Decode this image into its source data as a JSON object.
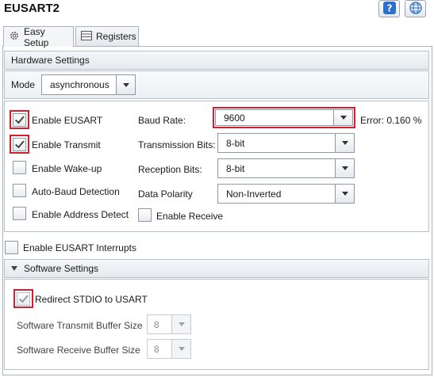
{
  "window": {
    "title": "EUSART2"
  },
  "header_buttons": [
    {
      "icon": "help-icon"
    },
    {
      "icon": "globe-icon"
    }
  ],
  "tabs": [
    {
      "label": "Easy Setup",
      "icon": "gear-icon",
      "active": true
    },
    {
      "label": "Registers",
      "icon": "register-list-icon",
      "active": false
    }
  ],
  "hardware": {
    "title": "Hardware Settings",
    "mode_label": "Mode",
    "mode_value": "asynchronous",
    "checkboxes": {
      "enable_eusart": {
        "label": "Enable EUSART",
        "checked": true
      },
      "enable_transmit": {
        "label": "Enable Transmit",
        "checked": true
      },
      "enable_wakeup": {
        "label": "Enable Wake-up",
        "checked": false
      },
      "auto_baud": {
        "label": "Auto-Baud Detection",
        "checked": false
      },
      "enable_address_detect": {
        "label": "Enable Address Detect",
        "checked": false
      },
      "enable_receive": {
        "label": "Enable Receive",
        "checked": false
      }
    },
    "baud_rate": {
      "label": "Baud Rate:",
      "value": "9600",
      "error": "Error: 0.160 %"
    },
    "transmission_bits": {
      "label": "Transmission Bits:",
      "value": "8-bit"
    },
    "reception_bits": {
      "label": "Reception Bits:",
      "value": "8-bit"
    },
    "data_polarity": {
      "label": "Data Polarity",
      "value": "Non-Inverted"
    }
  },
  "interrupts": {
    "label": "Enable EUSART Interrupts",
    "checked": false
  },
  "software": {
    "title": "Software Settings",
    "redirect_stdio": {
      "label": "Redirect STDIO to USART",
      "checked": true
    },
    "tx_buffer": {
      "label": "Software Transmit Buffer Size",
      "value": "8"
    },
    "rx_buffer": {
      "label": "Software Receive Buffer Size",
      "value": "8"
    }
  },
  "colors": {
    "highlight": "#d32030",
    "accent_help": "#2b6fcf"
  }
}
